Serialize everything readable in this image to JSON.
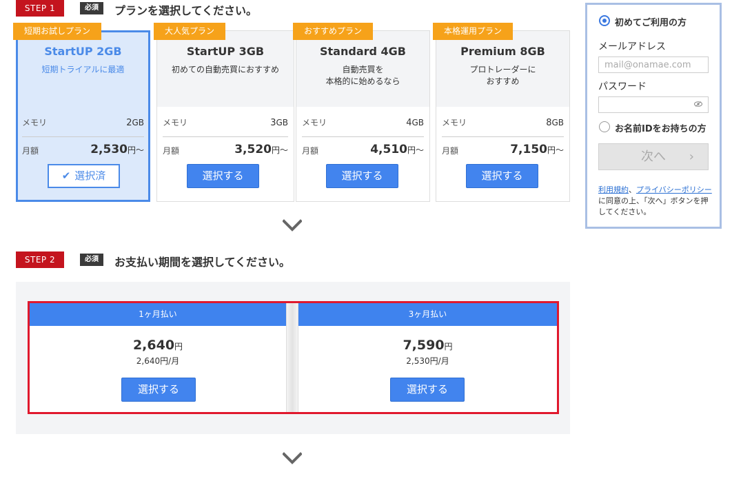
{
  "step1": {
    "badge": "STEP 1",
    "required": "必須",
    "title": "プランを選択してください。"
  },
  "plans": [
    {
      "tag": "短期お試しプラン",
      "name": "StartUP 2GB",
      "desc": "短期トライアルに最適",
      "memory_label": "メモリ",
      "memory_value": "2",
      "memory_unit": "GB",
      "price_label": "月額",
      "price": "2,530",
      "price_suffix": "円～",
      "button": "選択済",
      "selected": true
    },
    {
      "tag": "大人気プラン",
      "name": "StartUP 3GB",
      "desc": "初めての自動売買におすすめ",
      "memory_label": "メモリ",
      "memory_value": "3",
      "memory_unit": "GB",
      "price_label": "月額",
      "price": "3,520",
      "price_suffix": "円～",
      "button": "選択する",
      "selected": false
    },
    {
      "tag": "おすすめプラン",
      "name": "Standard 4GB",
      "desc": "自動売買を\n本格的に始めるなら",
      "memory_label": "メモリ",
      "memory_value": "4",
      "memory_unit": "GB",
      "price_label": "月額",
      "price": "4,510",
      "price_suffix": "円～",
      "button": "選択する",
      "selected": false
    },
    {
      "tag": "本格運用プラン",
      "name": "Premium 8GB",
      "desc": "プロトレーダーに\nおすすめ",
      "memory_label": "メモリ",
      "memory_value": "8",
      "memory_unit": "GB",
      "price_label": "月額",
      "price": "7,150",
      "price_suffix": "円～",
      "button": "選択する",
      "selected": false
    }
  ],
  "step2": {
    "badge": "STEP 2",
    "required": "必須",
    "title": "お支払い期間を選択してください。"
  },
  "payments": [
    {
      "period": "1ヶ月払い",
      "amount": "2,640",
      "currency": "円",
      "monthly": "2,640円/月",
      "button": "選択する"
    },
    {
      "period": "3ヶ月払い",
      "amount": "7,590",
      "currency": "円",
      "monthly": "2,530円/月",
      "button": "選択する"
    }
  ],
  "login": {
    "option_new": "初めてご利用の方",
    "email_label": "メールアドレス",
    "email_placeholder": "mail@onamae.com",
    "password_label": "パスワード",
    "password_value": "",
    "option_existing": "お名前IDをお持ちの方",
    "next_button": "次へ",
    "next_arrow": "›",
    "terms_link": "利用規約",
    "terms_sep": "、",
    "privacy_link": "プライバシーポリシー",
    "terms_text": "に同意の上、「次へ」ボタンを押してください。"
  },
  "colors": {
    "step_red": "#c4141e",
    "primary_blue": "#4284ee",
    "tag_orange": "#f6a21a",
    "selected_bg": "#dce9fb",
    "frame_red": "#e0182d"
  }
}
